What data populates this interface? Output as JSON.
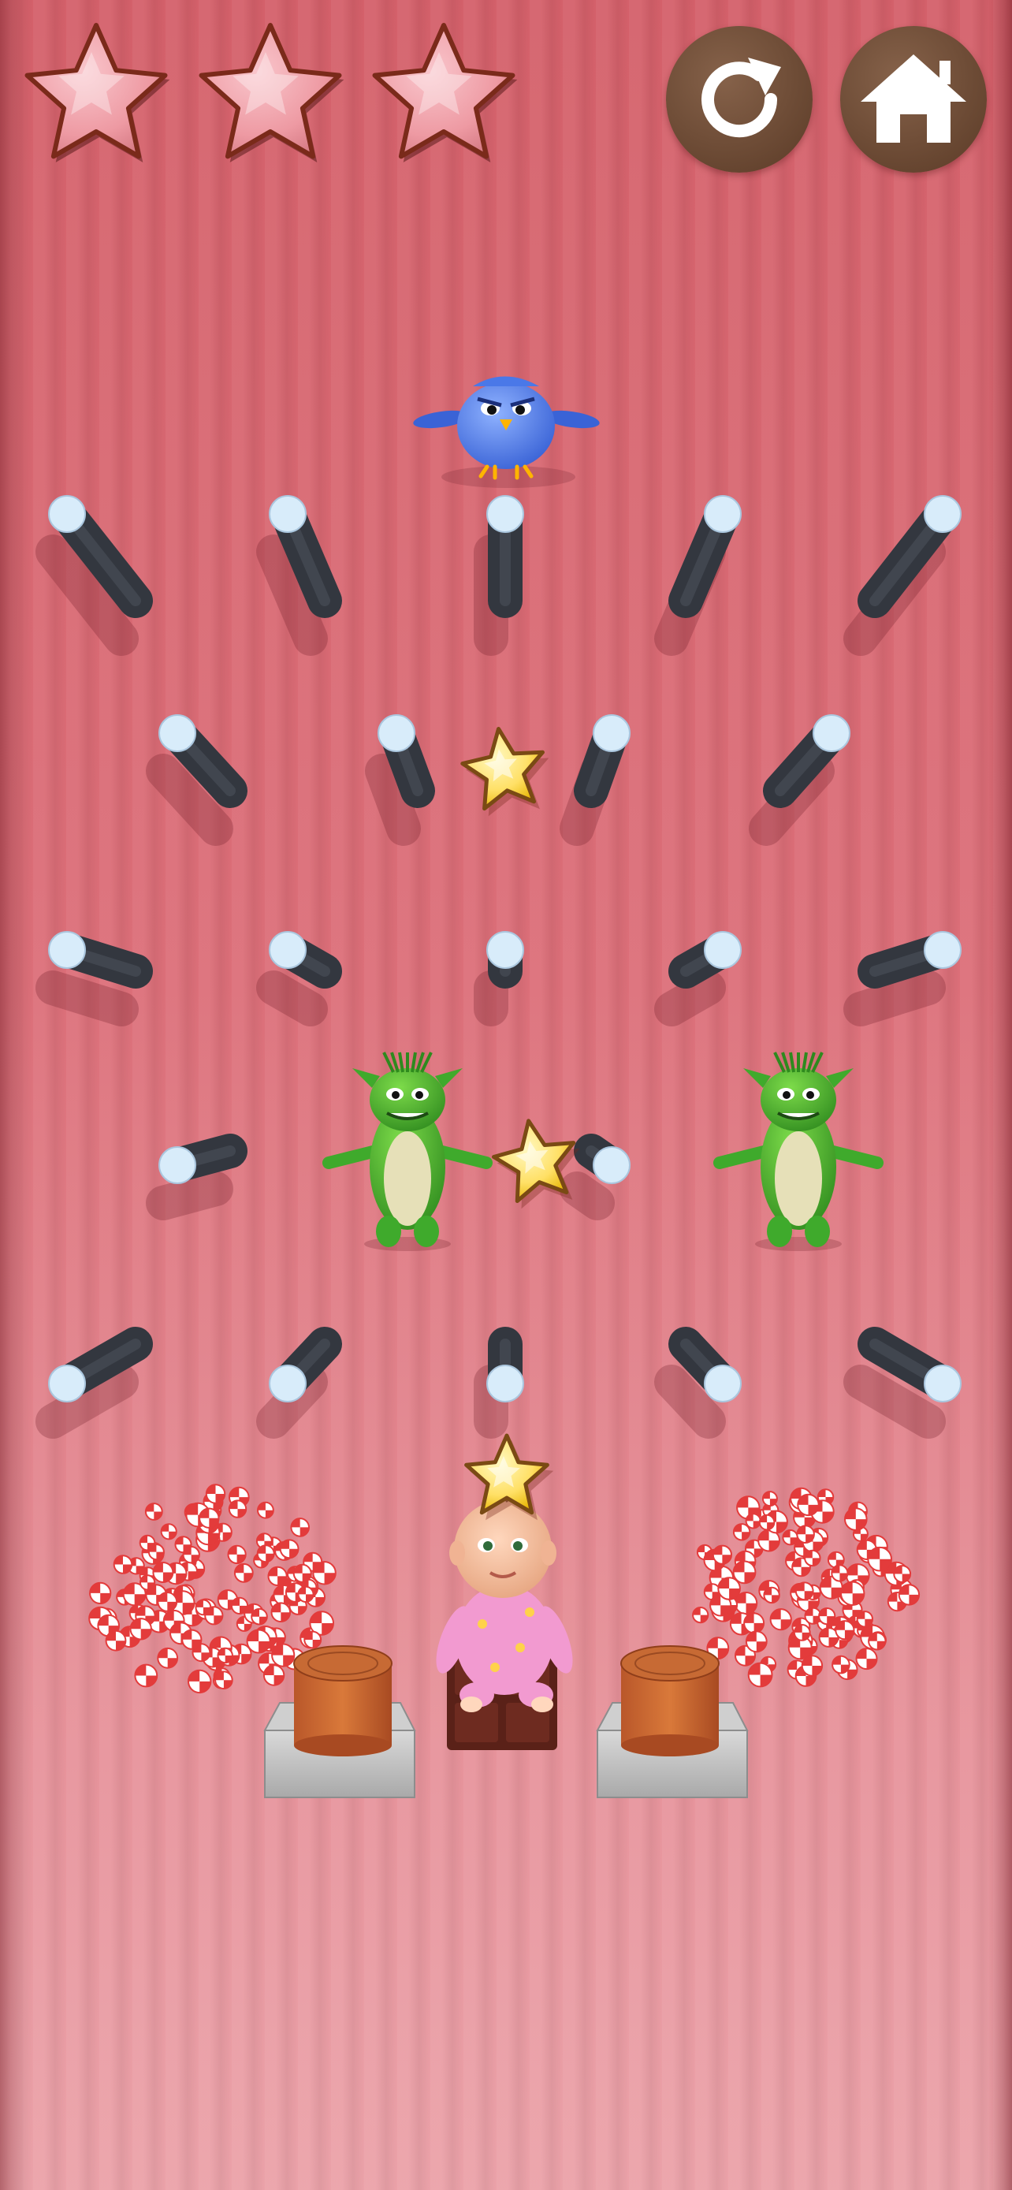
{
  "hud": {
    "rating_stars": [
      {
        "name": "rating-star-1",
        "filled": false
      },
      {
        "name": "rating-star-2",
        "filled": false
      },
      {
        "name": "rating-star-3",
        "filled": false
      }
    ],
    "buttons": [
      {
        "name": "restart-button",
        "icon": "restart-icon"
      },
      {
        "name": "home-button",
        "icon": "home-icon"
      }
    ]
  },
  "colors": {
    "background_top": "#d4606a",
    "background_bottom": "#eba2a9",
    "peg_body": "#3a3f47",
    "peg_cap": "#d8ecfa",
    "hud_button": "#6e4a34",
    "rating_star": "#f0a3ab",
    "collectible_star": "#ffe066",
    "bird": "#4a78e8",
    "monster": "#3faa2c",
    "candy": "#e33b3b"
  },
  "scene": {
    "bird": {
      "name": "blue-bird-ball"
    },
    "collectibles": [
      {
        "name": "collectible-star-1"
      },
      {
        "name": "collectible-star-2"
      },
      {
        "name": "collectible-star-3"
      }
    ],
    "monsters": [
      {
        "name": "green-monster-left"
      },
      {
        "name": "green-monster-right"
      }
    ],
    "baby": {
      "name": "baby-on-chocolate-block"
    },
    "cushions": [
      {
        "name": "wooden-cushion-left"
      },
      {
        "name": "wooden-cushion-right"
      }
    ],
    "candy_piles": [
      {
        "name": "candy-burst-left"
      },
      {
        "name": "candy-burst-right"
      }
    ]
  }
}
